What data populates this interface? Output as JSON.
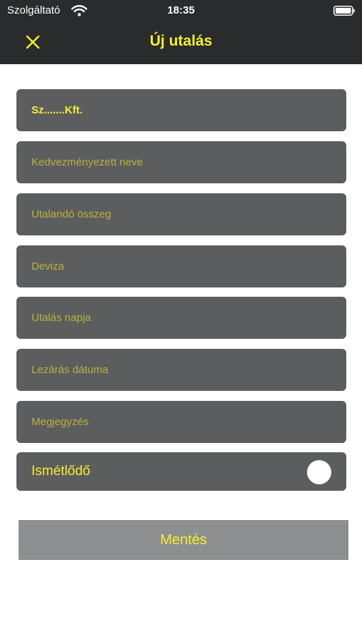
{
  "status_bar": {
    "carrier": "Szolgáltató",
    "time": "18:35"
  },
  "nav": {
    "title": "Új utalás"
  },
  "form": {
    "company": {
      "value": "Sz.......Kft."
    },
    "beneficiary": {
      "placeholder": "Kedvezményezett neve"
    },
    "amount": {
      "placeholder": "Utalandó összeg"
    },
    "currency": {
      "placeholder": "Deviza"
    },
    "transfer_date": {
      "placeholder": "Utalás napja"
    },
    "close_date": {
      "placeholder": "Lezárás dátuma"
    },
    "note": {
      "placeholder": "Megjegyzés"
    },
    "recurring": {
      "label": "Ismétlődő",
      "on": false
    }
  },
  "save_label": "Mentés",
  "colors": {
    "accent": "#f4f12a",
    "bar": "#2a2b2c",
    "field": "#5c5d5f",
    "button": "#8e8f90"
  }
}
